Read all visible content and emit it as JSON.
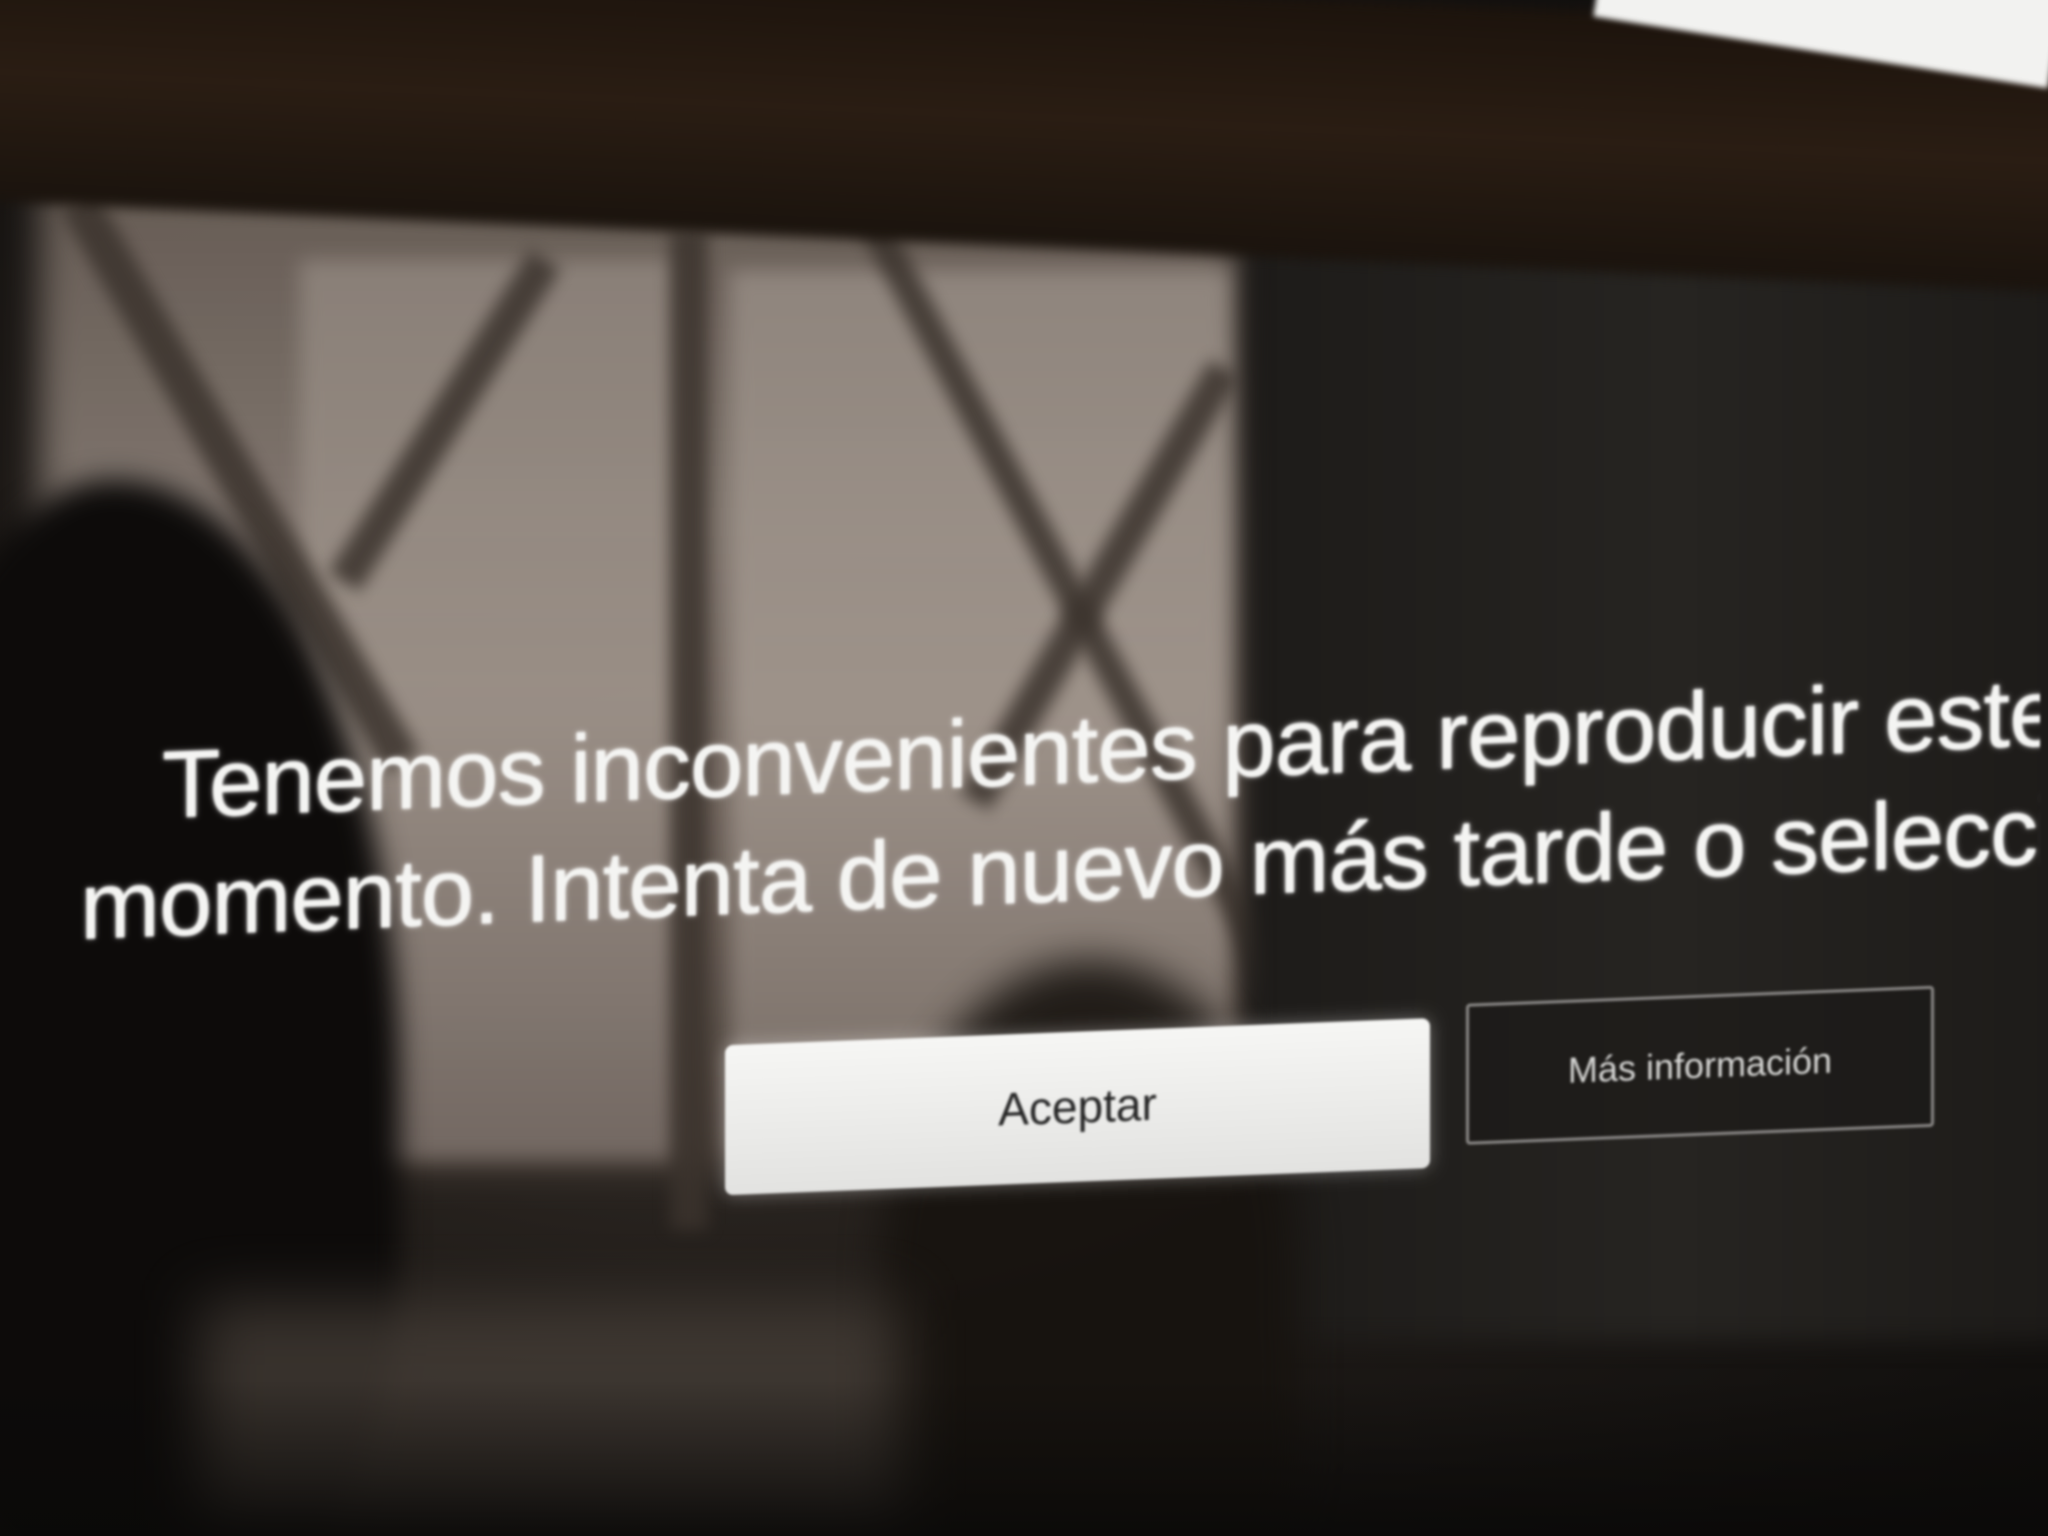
{
  "error_dialog": {
    "message_line_1": "Tenemos inconvenientes para reproducir este título en",
    "message_line_2": "momento. Intenta de nuevo más tarde o selecciona otro",
    "accept_label": "Aceptar",
    "more_info_label": "Más información"
  },
  "colors": {
    "message_text": "#f4f4f2",
    "accept_button_bg": "#f0f0ee",
    "accept_button_text": "#262626",
    "more_info_border": "#8a8886",
    "screen_background": "#1e1a17"
  }
}
